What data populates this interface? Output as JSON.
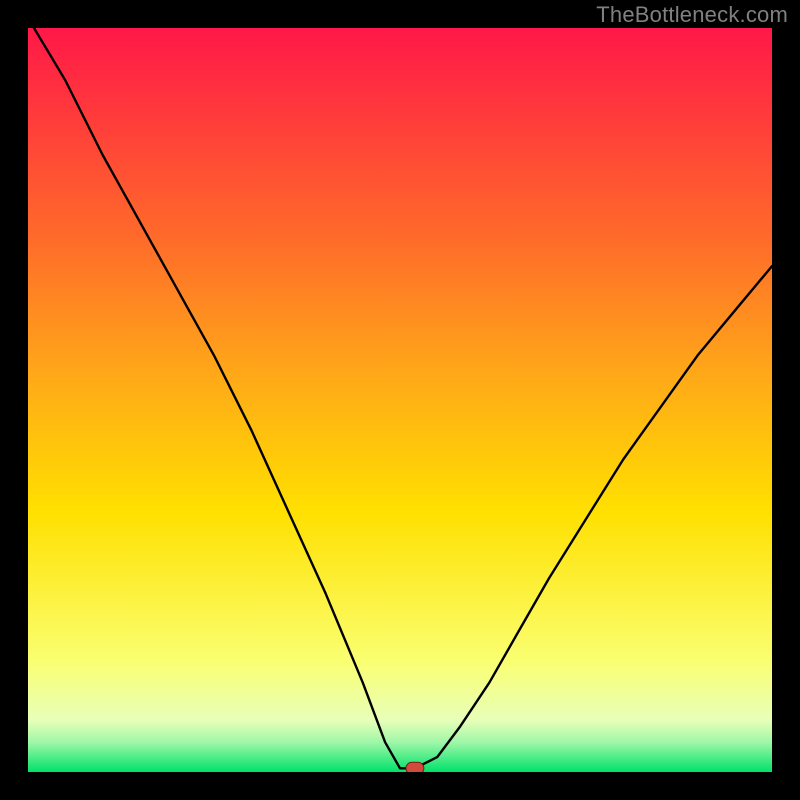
{
  "watermark": "TheBottleneck.com",
  "chart_data": {
    "type": "line",
    "title": "",
    "xlabel": "",
    "ylabel": "",
    "xlim": [
      0,
      100
    ],
    "ylim": [
      0,
      100
    ],
    "x": [
      0,
      5,
      10,
      15,
      20,
      25,
      30,
      35,
      40,
      45,
      48,
      50,
      52,
      55,
      58,
      62,
      66,
      70,
      75,
      80,
      85,
      90,
      95,
      100
    ],
    "values": [
      103,
      93,
      83,
      74,
      65,
      56,
      46,
      35,
      24,
      12,
      4,
      0.5,
      0.5,
      2,
      6,
      12,
      19,
      26,
      34,
      42,
      49,
      56,
      62,
      68
    ],
    "marker": {
      "x": 52,
      "y": 0.5
    },
    "green_band": {
      "y_start": 0,
      "y_end": 4
    },
    "background_gradient": {
      "top": "#ff1848",
      "mid_upper": "#ff8d1f",
      "mid": "#ffe000",
      "lower": "#fcff91",
      "bottom": "#00e26a"
    }
  }
}
